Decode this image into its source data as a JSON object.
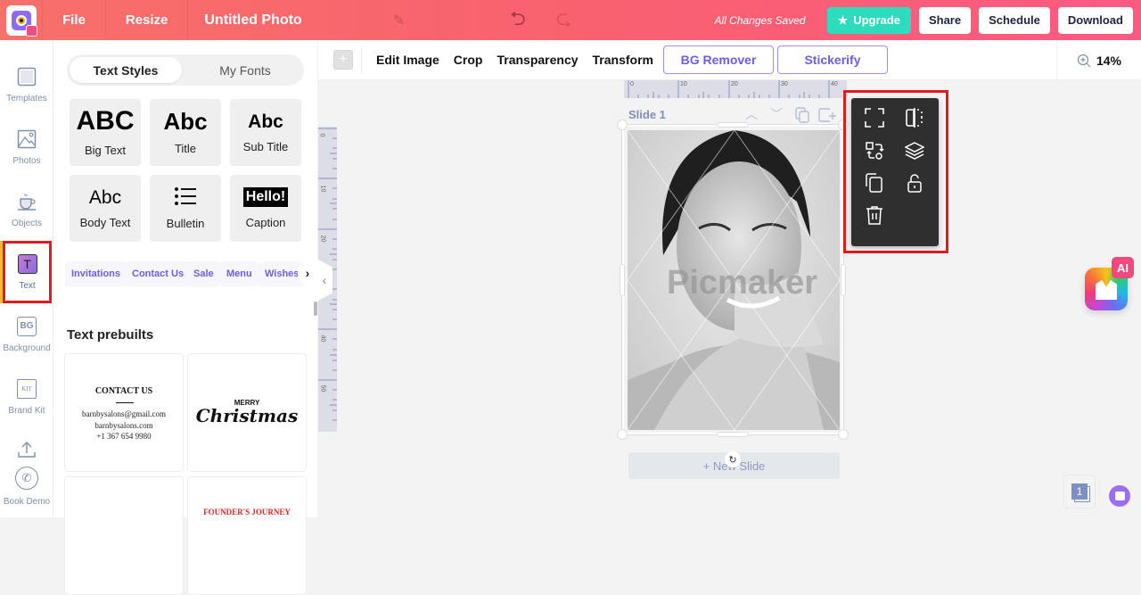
{
  "header": {
    "menu": [
      "File",
      "Resize"
    ],
    "document_title": "Untitled Photo",
    "save_status": "All Changes Saved",
    "buttons": {
      "upgrade": "Upgrade",
      "share": "Share",
      "schedule": "Schedule",
      "download": "Download"
    }
  },
  "rail": {
    "items": [
      {
        "label": "Templates",
        "icon": "templates-icon"
      },
      {
        "label": "Photos",
        "icon": "photos-icon"
      },
      {
        "label": "Objects",
        "icon": "objects-icon"
      },
      {
        "label": "Text",
        "icon": "text-icon",
        "active": true
      },
      {
        "label": "Background",
        "icon": "background-icon"
      },
      {
        "label": "Brand Kit",
        "icon": "brand-kit-icon"
      },
      {
        "label": "Book Demo",
        "icon": "phone-icon"
      }
    ],
    "bg_glyph": "BG",
    "kit_glyph": "KIT",
    "text_glyph": "T"
  },
  "panel": {
    "tabs": [
      {
        "label": "Text Styles",
        "active": true
      },
      {
        "label": "My Fonts",
        "active": false
      }
    ],
    "styles": [
      {
        "preview": "ABC",
        "label": "Big Text"
      },
      {
        "preview": "Abc",
        "label": "Title"
      },
      {
        "preview": "Abc",
        "label": "Sub Title"
      },
      {
        "preview": "Abc",
        "label": "Body Text"
      },
      {
        "preview": "",
        "label": "Bulletin"
      },
      {
        "preview": "Hello!",
        "label": "Caption"
      }
    ],
    "chips": [
      "Invitations",
      "Contact Us",
      "Sale",
      "Menu",
      "Wishes"
    ],
    "section_title": "Text prebuilts",
    "prebuilts": {
      "contact": {
        "heading": "CONTACT US",
        "lines": [
          "barnbysalons@gmail.com",
          "barnbysalons.com",
          "+1 367 654 9980"
        ]
      },
      "christmas": {
        "top": "MERRY",
        "script": "Christmas"
      },
      "founder": {
        "heading": "FOUNDER'S JOURNEY"
      }
    }
  },
  "toolbar": {
    "add": "+",
    "items": [
      "Edit Image",
      "Crop",
      "Transparency",
      "Transform"
    ],
    "outlined": [
      "BG Remover",
      "Stickerify"
    ],
    "zoom": "14%"
  },
  "canvas": {
    "ruler_top": [
      "0",
      "10",
      "20",
      "30",
      "40"
    ],
    "ruler_left": [
      "0",
      "10",
      "20",
      "40",
      "50"
    ],
    "slide_label": "Slide 1",
    "watermark": "Picmaker",
    "new_slide": "+ New Slide",
    "page_count": "1"
  },
  "context_menu": {
    "items": [
      "fit-icon",
      "flip-icon",
      "replace-icon",
      "layers-icon",
      "duplicate-icon",
      "unlock-icon",
      "delete-icon"
    ]
  },
  "ai_badge": "AI",
  "colors": {
    "header_start": "#f7706a",
    "header_end": "#fb5a82",
    "upgrade": "#2ddbbd",
    "accent": "#6c5ce7",
    "highlight": "#e01b1b"
  }
}
